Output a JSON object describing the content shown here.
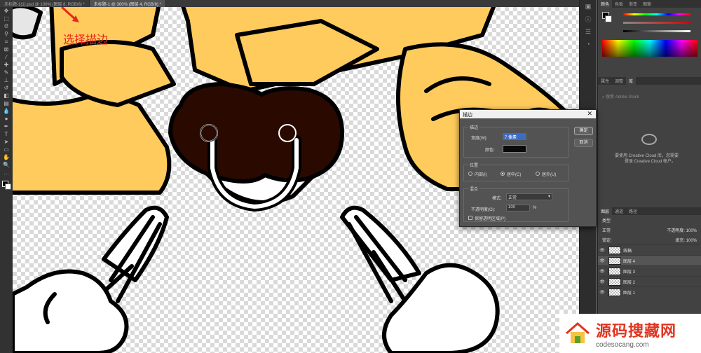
{
  "tabs": [
    {
      "label": "未标题-1(1).psd @ 100% (图层 8, RGB/8) *"
    },
    {
      "label": "未标题-1 @ 300% (图层 4, RGB/8) *"
    }
  ],
  "annotation": "选择描边",
  "toolbar_icons": [
    "move-icon",
    "marquee-icon",
    "lasso-icon",
    "magic-wand-icon",
    "crop-icon",
    "frame-icon",
    "eyedropper-icon",
    "healing-icon",
    "brush-icon",
    "stamp-icon",
    "history-brush-icon",
    "eraser-icon",
    "gradient-icon",
    "blur-icon",
    "dodge-icon",
    "pen-icon",
    "type-icon",
    "path-select-icon",
    "shape-icon",
    "hand-icon",
    "zoom-icon",
    "more-icon"
  ],
  "color_panel": {
    "tabs": [
      "颜色",
      "色板",
      "渐变",
      "图案"
    ]
  },
  "library_panel": {
    "tabs": [
      "属性",
      "调整",
      "库"
    ],
    "search_placeholder": "搜索 Adobe Stock",
    "message_line1": "要使用 Creative Cloud 库，您需要",
    "message_line2": "登录 Creative Cloud 帐户。"
  },
  "layers_panel": {
    "tabs": [
      "图层",
      "通道",
      "路径"
    ],
    "kind_label": "类型",
    "blend_mode": "正常",
    "opacity_label": "不透明度:",
    "opacity_value": "100%",
    "lock_label": "锁定:",
    "fill_label": "填充:",
    "fill_value": "100%",
    "layers": [
      {
        "name": "线稿"
      },
      {
        "name": "图层 4"
      },
      {
        "name": "图层 3"
      },
      {
        "name": "图层 2"
      },
      {
        "name": "图层 1"
      }
    ]
  },
  "dialog": {
    "title": "描边",
    "stroke_group": "描边",
    "width_label": "宽度(W):",
    "width_value": "7 像素",
    "color_label": "颜色:",
    "stroke_color": "#0a0a0a",
    "position_group": "位置",
    "position_options": [
      {
        "label": "内部(I)"
      },
      {
        "label": "居中(C)"
      },
      {
        "label": "居外(U)"
      }
    ],
    "position_selected": "居中(C)",
    "blend_group": "混合",
    "mode_label": "模式:",
    "mode_value": "正常",
    "opacity_label": "不透明度(O):",
    "opacity_value": "100",
    "opacity_unit": "%",
    "preserve_label": "保留透明区域(P)",
    "ok_label": "确定",
    "cancel_label": "取消"
  },
  "watermark": {
    "title": "源码搜藏网",
    "url": "codesocang.com"
  },
  "colors": {
    "accent": "#ffcb5c",
    "nose": "#2a0a00",
    "annotation": "#e8261e"
  }
}
